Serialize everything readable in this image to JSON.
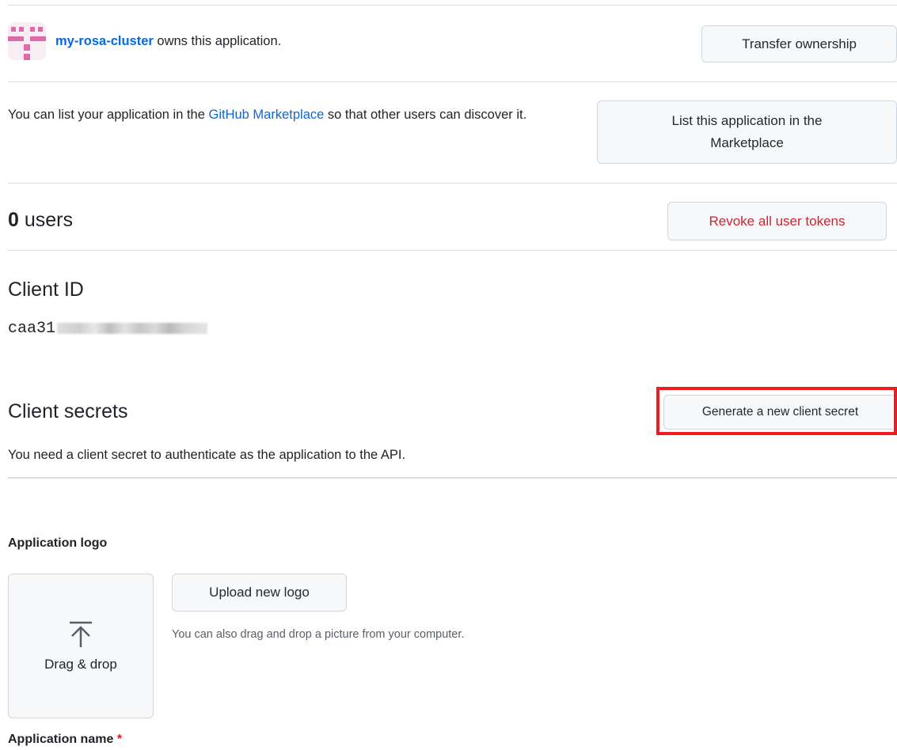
{
  "owner": {
    "name": "my-rosa-cluster",
    "suffix": "owns this application.",
    "transfer_button": "Transfer ownership"
  },
  "marketplace": {
    "text_before": "You can list your application in the",
    "link": "GitHub Marketplace",
    "text_after": "so that other users can discover it.",
    "button": "List this application in the Marketplace"
  },
  "users": {
    "count": "0",
    "label": "users",
    "revoke_button": "Revoke all user tokens"
  },
  "client_id": {
    "title": "Client ID",
    "value_prefix": "caa31"
  },
  "client_secrets": {
    "title": "Client secrets",
    "button": "Generate a new client secret",
    "description": "You need a client secret to authenticate as the application to the API."
  },
  "logo": {
    "label": "Application logo",
    "dropzone_icon": "upload-arrow-icon",
    "dropzone_text": "Drag & drop",
    "upload_button": "Upload new logo",
    "help_text": "You can also drag and drop a picture from your computer."
  },
  "app_name": {
    "label": "Application name",
    "required_mark": "*"
  },
  "colors": {
    "link": "#0969da",
    "danger": "#cf222e",
    "highlight": "#ee1c1c",
    "avatar": "#e06aa8"
  }
}
